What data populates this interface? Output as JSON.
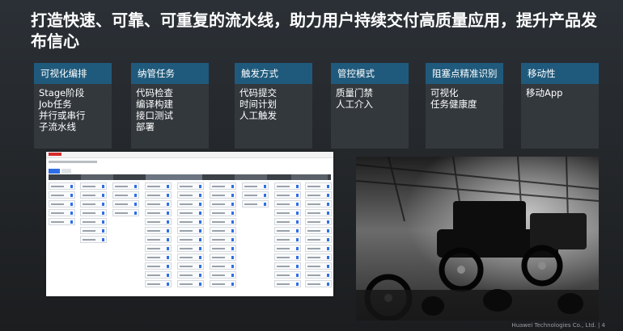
{
  "title": "打造快速、可靠、可重复的流水线，助力用户持续交付高质量应用，提升产品发布信心",
  "cards": [
    {
      "header": "可视化编排",
      "lines": [
        "Stage阶段",
        "Job任务",
        "并行或串行",
        "子流水线"
      ]
    },
    {
      "header": "纳管任务",
      "lines": [
        "代码检查",
        "编译构建",
        "接口测试",
        "部署"
      ]
    },
    {
      "header": "触发方式",
      "lines": [
        "代码提交",
        "时间计划",
        "人工触发"
      ]
    },
    {
      "header": "管控模式",
      "lines": [
        "质量门禁",
        "人工介入"
      ]
    },
    {
      "header": "阻塞点精准识别",
      "lines": [
        "可视化",
        "任务健康度"
      ]
    },
    {
      "header": "移动性",
      "lines": [
        "移动App"
      ]
    }
  ],
  "footer": "Huawei Technologies Co., Ltd.  |  4",
  "colors": {
    "card_header": "#1f5a7c",
    "card_body": "#33383d",
    "background": "#23272b"
  }
}
